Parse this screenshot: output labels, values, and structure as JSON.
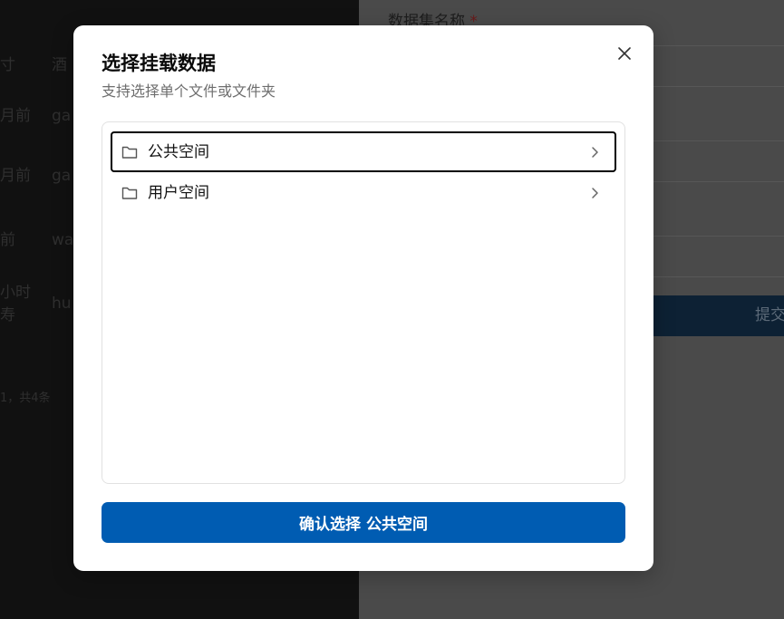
{
  "background": {
    "left_rows": [
      {
        "time": "寸",
        "name": "酒"
      },
      {
        "time": "月前",
        "name": "ga"
      },
      {
        "time": "月前",
        "name": "ga"
      },
      {
        "time": "前",
        "name": "wa"
      },
      {
        "time": "小时",
        "time2": "寿",
        "name": "hu"
      }
    ],
    "footer_text": "1，共4条",
    "form_label": "数据集名称",
    "required_mark": "*",
    "submit_label": "提交"
  },
  "modal": {
    "title": "选择挂载数据",
    "subtitle": "支持选择单个文件或文件夹",
    "close_icon": "close-icon",
    "items": [
      {
        "label": "公共空间",
        "icon": "folder-icon",
        "selected": true
      },
      {
        "label": "用户空间",
        "icon": "folder-icon",
        "selected": false
      }
    ],
    "confirm_prefix": "确认选择 ",
    "confirm_target": "公共空间"
  },
  "colors": {
    "primary": "#005cb2",
    "selected_border": "#000000"
  }
}
